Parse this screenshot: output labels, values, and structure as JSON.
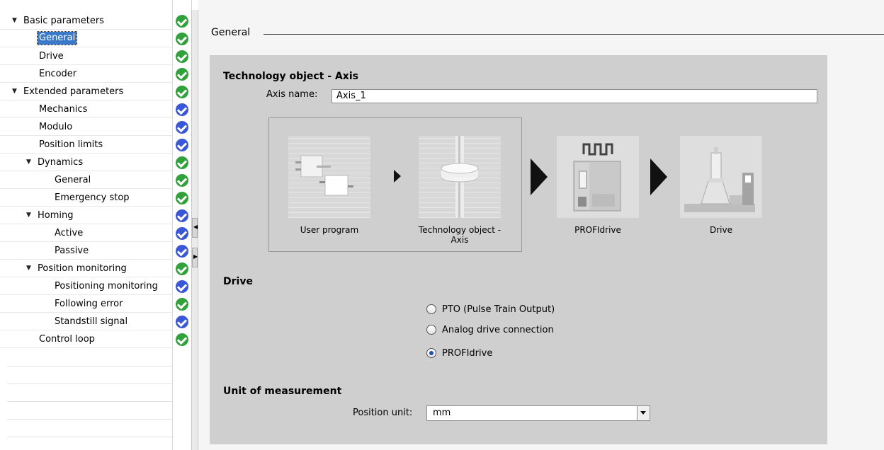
{
  "tree": {
    "items": [
      {
        "label": "Basic parameters",
        "expandable": true,
        "status": "green"
      },
      {
        "label": "General",
        "selected": true,
        "status": "green"
      },
      {
        "label": "Drive",
        "status": "green"
      },
      {
        "label": "Encoder",
        "status": "green"
      },
      {
        "label": "Extended parameters",
        "expandable": true,
        "status": "green"
      },
      {
        "label": "Mechanics",
        "status": "blue"
      },
      {
        "label": "Modulo",
        "status": "blue"
      },
      {
        "label": "Position limits",
        "status": "blue"
      },
      {
        "label": "Dynamics",
        "expandable": true,
        "status": "green"
      },
      {
        "label": "General",
        "status": "green"
      },
      {
        "label": "Emergency stop",
        "status": "green"
      },
      {
        "label": "Homing",
        "expandable": true,
        "status": "blue"
      },
      {
        "label": "Active",
        "status": "blue"
      },
      {
        "label": "Passive",
        "status": "blue"
      },
      {
        "label": "Position monitoring",
        "expandable": true,
        "status": "green"
      },
      {
        "label": "Positioning monitoring",
        "status": "blue"
      },
      {
        "label": "Following error",
        "status": "green"
      },
      {
        "label": "Standstill signal",
        "status": "blue"
      },
      {
        "label": "Control loop",
        "status": "green"
      }
    ],
    "status_colors": {
      "green": "#31a23b",
      "blue": "#3a57d8"
    },
    "expand_icon": "triangle-down-icon",
    "status_icon": "check-circle-icon"
  },
  "section": {
    "title": "General"
  },
  "technology_object": {
    "heading": "Technology object - Axis",
    "axis_name_label": "Axis name:",
    "axis_name_value": "Axis_1"
  },
  "diagram": {
    "user_program": "User program",
    "tech_object_line1": "Technology object -",
    "tech_object_line2": "Axis",
    "profidrive": "PROFIdrive",
    "drive": "Drive"
  },
  "drive": {
    "heading": "Drive",
    "options": [
      {
        "label": "PTO (Pulse Train Output)",
        "selected": false
      },
      {
        "label": "Analog drive connection",
        "selected": false
      },
      {
        "label": "PROFIdrive",
        "selected": true
      }
    ]
  },
  "unit": {
    "heading": "Unit of measurement",
    "position_unit_label": "Position unit:",
    "position_unit_value": "mm"
  },
  "colors": {
    "selection": "#3a79c9",
    "panel": "#cfcfcf",
    "radio_selected": "#1f4fb0"
  }
}
